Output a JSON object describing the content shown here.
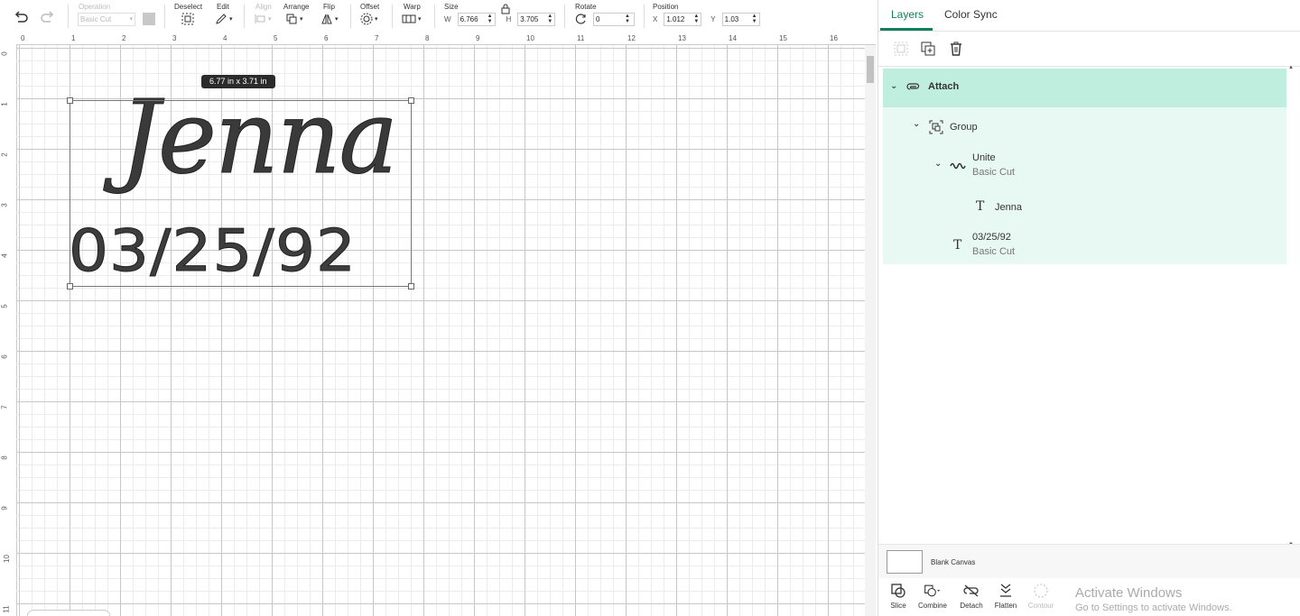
{
  "toolbar": {
    "operation_label": "Operation",
    "operation_value": "Basic Cut",
    "deselect_label": "Deselect",
    "edit_label": "Edit",
    "align_label": "Align",
    "arrange_label": "Arrange",
    "flip_label": "Flip",
    "offset_label": "Offset",
    "warp_label": "Warp",
    "size_label": "Size",
    "size_w_label": "W",
    "size_w_value": "6.766",
    "size_h_label": "H",
    "size_h_value": "3.705",
    "rotate_label": "Rotate",
    "rotate_value": "0",
    "position_label": "Position",
    "position_x_label": "X",
    "position_x_value": "1.012",
    "position_y_label": "Y",
    "position_y_value": "1.03"
  },
  "canvas": {
    "ruler_top": [
      "0",
      "1",
      "2",
      "3",
      "4",
      "5",
      "6",
      "7",
      "8",
      "9",
      "10",
      "11",
      "12",
      "13",
      "14",
      "15",
      "16"
    ],
    "ruler_left": [
      "0",
      "1",
      "2",
      "3",
      "4",
      "5",
      "6",
      "7",
      "8",
      "9",
      "10",
      "11"
    ],
    "dimension_tooltip": "6.77  in x 3.71  in",
    "text_name": "Jenna",
    "text_date": "03/25/92"
  },
  "panel": {
    "tabs": [
      "Layers",
      "Color Sync"
    ],
    "active_tab": "Layers",
    "layers": {
      "attach": "Attach",
      "group": "Group",
      "unite": "Unite",
      "unite_sub": "Basic Cut",
      "jenna": "Jenna",
      "date": "03/25/92",
      "date_sub": "Basic Cut"
    },
    "blank_canvas": "Blank Canvas",
    "bottom_tools": [
      "Slice",
      "Combine",
      "Detach",
      "Flatten",
      "Contour"
    ]
  },
  "watermark": {
    "line1": "Activate Windows",
    "line2": "Go to Settings to activate Windows."
  },
  "colors": {
    "accent": "#14805b",
    "layer_selected": "#bfeedf",
    "layer_sub": "#e8f8f2"
  }
}
